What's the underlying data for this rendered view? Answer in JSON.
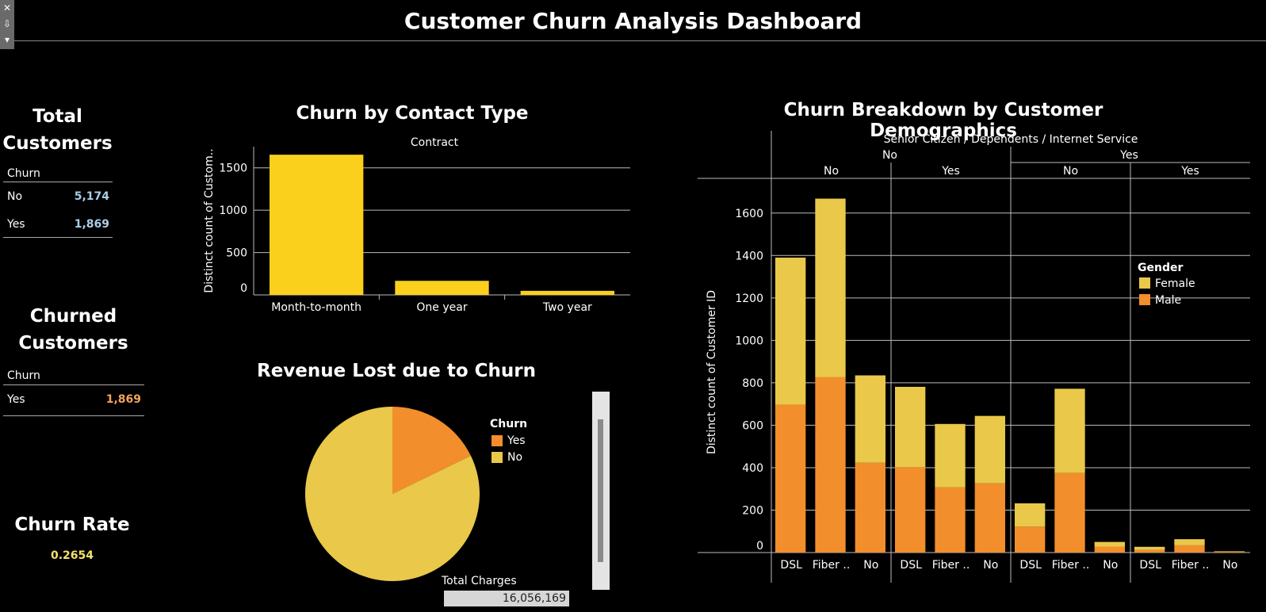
{
  "dashboard": {
    "title": "Customer Churn Analysis Dashboard"
  },
  "toolbar": {
    "close": "✕",
    "pin": "⇩",
    "menu": "▾"
  },
  "total_customers": {
    "title_line1": "Total",
    "title_line2": "Customers",
    "header": "Churn",
    "rows": [
      {
        "label": "No",
        "value": "5,174"
      },
      {
        "label": "Yes",
        "value": "1,869"
      }
    ],
    "value_color": "#a9cfe6"
  },
  "churned_customers": {
    "title_line1": "Churned",
    "title_line2": "Customers",
    "header": "Churn",
    "rows": [
      {
        "label": "Yes",
        "value": "1,869"
      }
    ],
    "value_color": "#f5a35c"
  },
  "churn_rate": {
    "title": "Churn Rate",
    "value": "0.2654",
    "value_color": "#f3e36a"
  },
  "revenue": {
    "title": "Revenue Lost due to Churn",
    "legend_title": "Churn",
    "legend": [
      {
        "label": "Yes",
        "color": "#f28e2b"
      },
      {
        "label": "No",
        "color": "#e9c84a"
      }
    ],
    "filter_label": "Total Charges",
    "filter_value": "16,056,169"
  },
  "contract_chart": {
    "title": "Churn by Contact Type",
    "header": "Contract"
  },
  "demo_chart": {
    "title": "Churn Breakdown by Customer Demographics",
    "header": "Senior Citizen  /  Dependents  /  Internet Service",
    "legend_title": "Gender"
  },
  "chart_data": [
    {
      "type": "bar",
      "title": "Churn by Contact Type",
      "xlabel": "Contract",
      "ylabel": "Distinct count of Custom..",
      "categories": [
        "Month-to-month",
        "One year",
        "Two year"
      ],
      "values": [
        1655,
        166,
        48
      ],
      "yticks": [
        0,
        500,
        1000,
        1500
      ],
      "ylim": [
        0,
        1750
      ],
      "grid": true,
      "color": "#fbd01c"
    },
    {
      "type": "pie",
      "title": "Revenue Lost due to Churn",
      "legend_title": "Churn",
      "slices": [
        {
          "label": "Yes",
          "value": 17.8,
          "color": "#f28e2b"
        },
        {
          "label": "No",
          "value": 82.2,
          "color": "#e9c84a"
        }
      ]
    },
    {
      "type": "bar",
      "stacked": true,
      "title": "Churn Breakdown by Customer Demographics",
      "header": "Senior Citizen / Dependents / Internet Service",
      "ylabel": "Distinct count of Customer ID",
      "yticks": [
        0,
        200,
        400,
        600,
        800,
        1000,
        1200,
        1400,
        1600
      ],
      "ylim": [
        0,
        1700
      ],
      "legend_title": "Gender",
      "legend_position": "right",
      "groups": [
        {
          "senior": "No",
          "dependents": "No"
        },
        {
          "senior": "No",
          "dependents": "Yes"
        },
        {
          "senior": "Yes",
          "dependents": "No"
        },
        {
          "senior": "Yes",
          "dependents": "Yes"
        }
      ],
      "categories": [
        "DSL",
        "Fiber ..",
        "No",
        "DSL",
        "Fiber ..",
        "No",
        "DSL",
        "Fiber ..",
        "No",
        "DSL",
        "Fiber ..",
        "No"
      ],
      "series": [
        {
          "name": "Male",
          "color": "#f28e2b",
          "values": [
            697,
            826,
            423,
            402,
            307,
            326,
            122,
            375,
            28,
            12,
            34,
            3
          ]
        },
        {
          "name": "Female",
          "color": "#e9c84a",
          "values": [
            693,
            842,
            412,
            379,
            299,
            318,
            110,
            397,
            22,
            15,
            29,
            3
          ]
        }
      ]
    }
  ]
}
